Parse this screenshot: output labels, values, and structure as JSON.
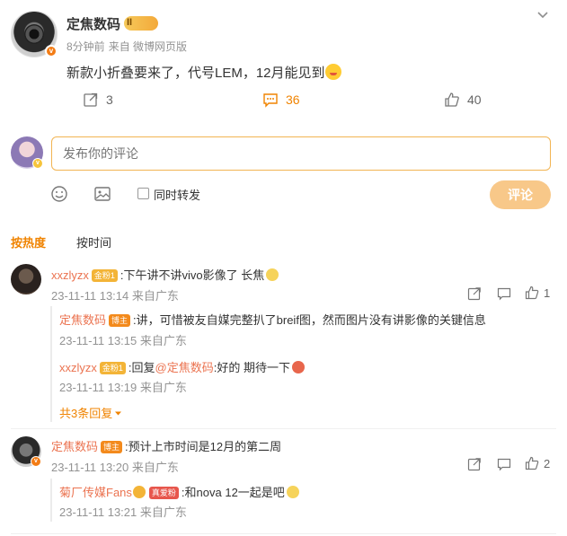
{
  "post": {
    "author": "定焦数码",
    "level_badge": "II",
    "time": "8分钟前",
    "source": "来自 微博网页版",
    "text": "新款小折叠要来了，代号LEM，12月能见到",
    "actions": {
      "share_count": "3",
      "comment_count": "36",
      "like_count": "40"
    }
  },
  "composer": {
    "placeholder": "发布你的评论",
    "forward_label": "同时转发",
    "submit_label": "评论"
  },
  "tabs": [
    {
      "label": "按热度",
      "active": true
    },
    {
      "label": "按时间",
      "active": false
    }
  ],
  "comments": [
    {
      "user": "xxzlyzx",
      "badge": "金粉1",
      "text": ":下午讲不讲vivo影像了 长焦",
      "time": "23-11-11 13:14 来自广东",
      "likes": "1",
      "replies": [
        {
          "user": "定焦数码",
          "badge": "博主",
          "text": ":讲，可惜被友自媒完整扒了breif图，然而图片没有讲影像的关键信息",
          "time": "23-11-11 13:15 来自广东"
        },
        {
          "user": "xxzlyzx",
          "badge": "金粉1",
          "reply_prefix": ":回复",
          "mention": "@定焦数码",
          "text": ":好的 期待一下",
          "time": "23-11-11 13:19 来自广东"
        }
      ],
      "more_replies": "共3条回复"
    },
    {
      "user": "定焦数码",
      "badge": "博主",
      "text": ":预计上市时间是12月的第二周",
      "time": "23-11-11 13:20 来自广东",
      "likes": "2",
      "replies": [
        {
          "user": "菊厂传媒Fans",
          "badge": "真爱粉",
          "text": ":和nova 12一起是吧",
          "time": "23-11-11 13:21 来自广东"
        }
      ]
    }
  ],
  "colors": {
    "accent": "#f08300",
    "username": "#eb7350",
    "meta": "#939393",
    "input_border": "#f2b452",
    "submit_bg": "#f8c889"
  }
}
